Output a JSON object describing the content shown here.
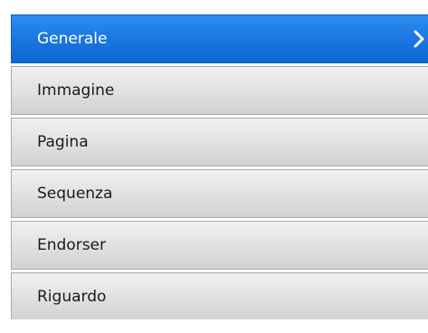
{
  "menu": {
    "items": [
      {
        "label": "Generale",
        "active": true
      },
      {
        "label": "Immagine",
        "active": false
      },
      {
        "label": "Pagina",
        "active": false
      },
      {
        "label": "Sequenza",
        "active": false
      },
      {
        "label": "Endorser",
        "active": false
      },
      {
        "label": "Riguardo",
        "active": false
      }
    ],
    "active_icon": "chevron-right-icon"
  },
  "colors": {
    "active_background": "#1a77e0",
    "active_text": "#ffffff",
    "inactive_background": "#e0e0e0",
    "inactive_text": "#1a1a1a",
    "border": "#a9a9a9"
  }
}
